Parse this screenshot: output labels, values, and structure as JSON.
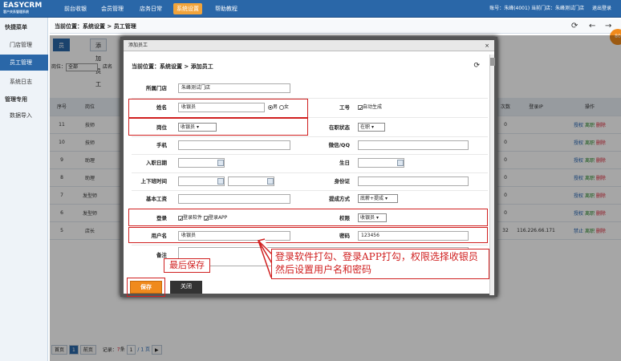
{
  "app": {
    "logo_main": "EASYCRM",
    "logo_sub": "客户关系管理系统"
  },
  "nav": [
    {
      "label": "前台收银"
    },
    {
      "label": "会员管理"
    },
    {
      "label": "店务日常"
    },
    {
      "label": "系统设置"
    },
    {
      "label": "帮助教程"
    }
  ],
  "account": {
    "text": "账号：朱峰(4001)  当前门店：朱峰测试门店",
    "logout": "退出登录"
  },
  "sidebar": [
    {
      "label": "快捷菜单"
    },
    {
      "label": "门店管理"
    },
    {
      "label": "员工管理"
    },
    {
      "label": "系统日志"
    },
    {
      "label": "管理专用"
    },
    {
      "label": "数据导入"
    }
  ],
  "breadcrumb": "当前位置：系统设置 > 员工管理",
  "badge": "80",
  "bg": {
    "tabs": [
      {
        "label": "员工列表"
      },
      {
        "label": "添加员工"
      }
    ],
    "filter": {
      "pos_label": "岗位：",
      "pos_value": "全部",
      "store_label": "店名"
    },
    "headers": [
      "序号",
      "岗位",
      "次数",
      "登录IP",
      "操作"
    ],
    "rows": [
      {
        "no": "11",
        "pos": "技师",
        "count": "0",
        "ip": ""
      },
      {
        "no": "10",
        "pos": "技师",
        "count": "0",
        "ip": ""
      },
      {
        "no": "9",
        "pos": "助理",
        "count": "0",
        "ip": ""
      },
      {
        "no": "8",
        "pos": "助理",
        "count": "0",
        "ip": ""
      },
      {
        "no": "7",
        "pos": "发型师",
        "count": "0",
        "ip": ""
      },
      {
        "no": "6",
        "pos": "发型师",
        "count": "0",
        "ip": ""
      },
      {
        "no": "5",
        "pos": "店长",
        "count": "32",
        "ip": "116.226.66.171"
      }
    ],
    "actions": {
      "a1": "授权",
      "a2": "离职",
      "a3": "删除",
      "b1": "禁止"
    },
    "pager": {
      "first": "首页",
      "prev": "前页",
      "record_label": "记录：",
      "record_count": "7",
      "record_unit": "条",
      "page_current": "1",
      "page_total": "/ 1 页",
      "page_num": "1"
    }
  },
  "dialog": {
    "title": "添加员工",
    "close": "×",
    "crumb": "当前位置：系统设置 > 添加员工",
    "fields": {
      "store_label": "所属门店",
      "store_value": "朱峰测试门店",
      "name_label": "姓名",
      "name_value": "收银员",
      "male": "男",
      "female": "女",
      "jobno_label": "工号",
      "auto_gen": "自动生成",
      "pos_label": "岗位",
      "pos_value": "收银员",
      "status_label": "在职状态",
      "status_value": "在职",
      "phone_label": "手机",
      "wechat_label": "微信/QQ",
      "entry_label": "入职日期",
      "birthday_label": "生日",
      "shift_label": "上下班时间",
      "idcard_label": "身份证",
      "salary_label": "基本工资",
      "commission_label": "提成方式",
      "commission_value": "底薪+提成",
      "login_label": "登录",
      "login_soft": "登录软件",
      "login_app": "登录APP",
      "perm_label": "权限",
      "perm_value": "收银员",
      "user_label": "用户名",
      "user_value": "收银员",
      "pwd_label": "密码",
      "pwd_value": "123456",
      "note_label": "备注"
    },
    "save": "保存",
    "close_btn": "关闭"
  },
  "annotations": {
    "save_note": "最后保存",
    "main_note_line1": "登录软件打勾、登录APP打勾，权限选择收银员",
    "main_note_line2": "然后设置用户名和密码"
  },
  "colors": {
    "topbar": "#2a67a8",
    "accent": "#f08a1c",
    "annotation": "#d02020"
  }
}
